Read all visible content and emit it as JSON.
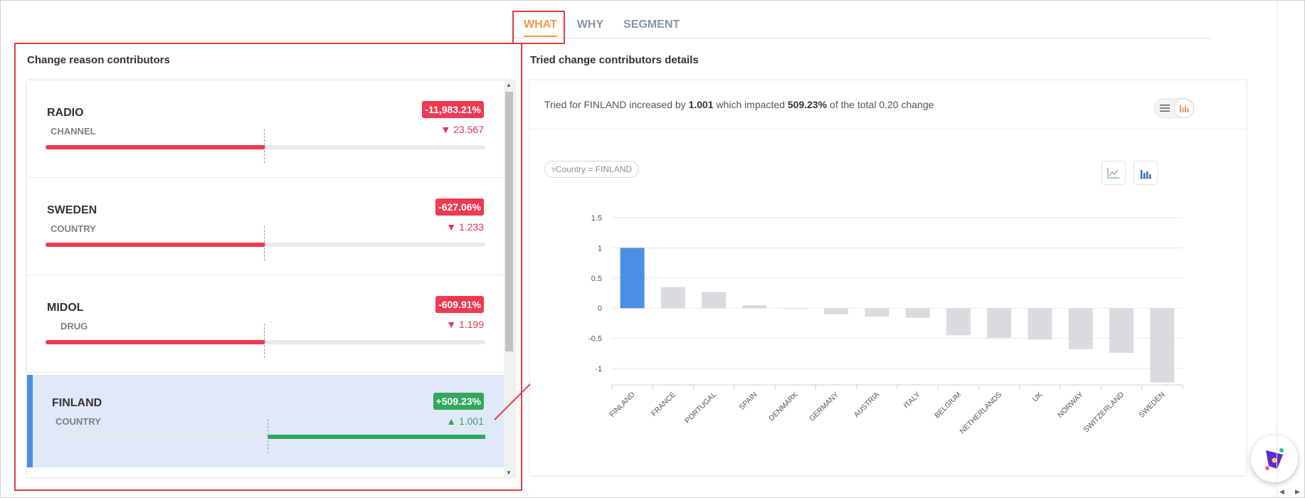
{
  "tabs": [
    {
      "label": "WHAT",
      "active": true
    },
    {
      "label": "WHY",
      "active": false
    },
    {
      "label": "SEGMENT",
      "active": false
    }
  ],
  "left_panel": {
    "title": "Change reason contributors",
    "items": [
      {
        "name": "RADIO",
        "type": "CHANNEL",
        "badge": "-11,983.21%",
        "delta": "23.567",
        "direction": "down"
      },
      {
        "name": "SWEDEN",
        "type": "COUNTRY",
        "badge": "-627.06%",
        "delta": "1.233",
        "direction": "down"
      },
      {
        "name": "MIDOL",
        "type": "DRUG",
        "badge": "-609.91%",
        "delta": "1.199",
        "direction": "down"
      },
      {
        "name": "FINLAND",
        "type": "COUNTRY",
        "badge": "+509.23%",
        "delta": "1.001",
        "direction": "up",
        "selected": true
      }
    ]
  },
  "right_panel": {
    "title": "Tried change contributors details",
    "summary": {
      "prefix": "Tried for FINLAND increased by ",
      "value": "1.001",
      "middle": " which impacted ",
      "impact": "509.23%",
      "suffix": " of the total 0.20 change"
    },
    "filter_chip": "Country = FINLAND"
  },
  "colors": {
    "accent": "#f2994a",
    "negative": "#ee3a52",
    "positive": "#31a85c",
    "highlight_bar": "#4a8ee8",
    "muted_bar": "#d9dbdf",
    "selected_row": "#dfe9f7"
  },
  "chart_data": {
    "type": "bar",
    "categories": [
      "FINLAND",
      "FRANCE",
      "PORTUGAL",
      "SPAIN",
      "DENMARK",
      "GERMANY",
      "AUSTRIA",
      "ITALY",
      "BELGIUM",
      "NETHERLANDS",
      "UK",
      "NORWAY",
      "SWITZERLAND",
      "SWEDEN"
    ],
    "values": [
      1.0,
      0.35,
      0.27,
      0.05,
      -0.01,
      -0.1,
      -0.14,
      -0.16,
      -0.45,
      -0.49,
      -0.52,
      -0.68,
      -0.74,
      -1.23
    ],
    "highlight": "FINLAND",
    "yticks": [
      "1.5",
      "1",
      "0.5",
      "0",
      "-0.5",
      "-1"
    ],
    "ylim": [
      -1.35,
      1.5
    ],
    "grid": true,
    "title": "",
    "xlabel": "",
    "ylabel": ""
  }
}
